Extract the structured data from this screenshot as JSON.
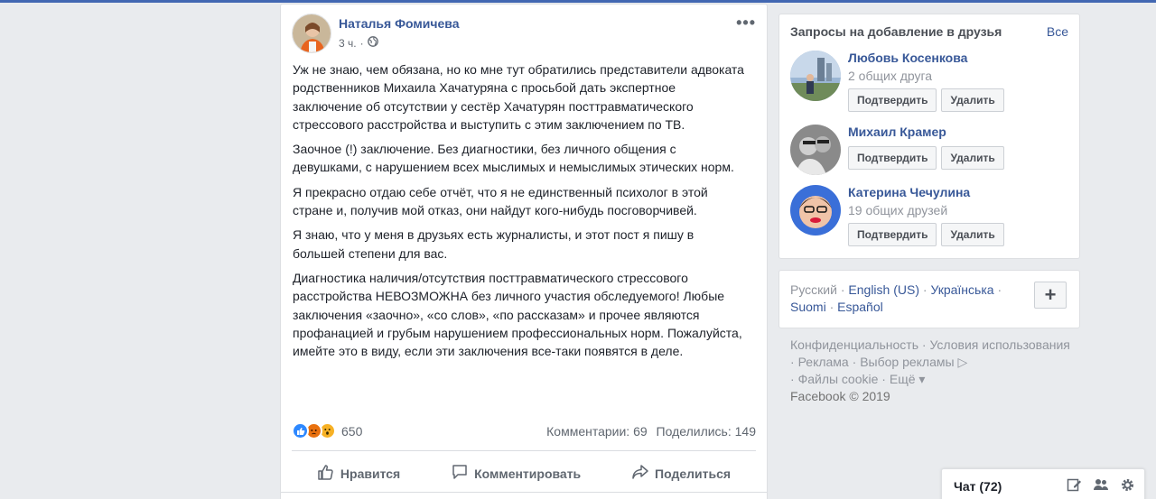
{
  "post": {
    "author": "Наталья Фомичева",
    "time": "3 ч.",
    "separator": "·",
    "paragraphs": [
      "Уж не знаю, чем обязана, но ко мне тут обратились представители адвоката родственников Михаила Хачатуряна с просьбой дать экспертное заключение об отсутствии у сестёр Хачатурян посттравматического стрессового расстройства и выступить с этим заключением по ТВ.",
      "Заочное (!) заключение. Без диагностики, без личного общения с девушками, с нарушением всех мыслимых и немыслимых этических норм.",
      "Я прекрасно отдаю себе отчёт, что я не единственный психолог в этой стране и, получив мой отказ, они найдут кого-нибудь посговорчивей.",
      "Я знаю, что у меня в друзьях есть журналисты, и этот пост я пишу в большей степени для вас.",
      "Диагностика наличия/отсутствия посттравматического стрессового расстройства НЕВОЗМОЖНА без личного участия обследуемого! Любые заключения «заочно», «со слов», «по рассказам» и прочее являются профанацией и грубым нарушением профессиональных норм. Пожалуйста, имейте это в виду, если эти заключения все-таки появятся в деле."
    ],
    "reactions_count": "650",
    "comments": "Комментарии: 69",
    "shares": "Поделились: 149",
    "actions": {
      "like": "Нравится",
      "comment": "Комментировать",
      "share": "Поделиться"
    }
  },
  "friend_requests": {
    "title": "Запросы на добавление в друзья",
    "see_all": "Все",
    "confirm": "Подтвердить",
    "delete": "Удалить",
    "items": [
      {
        "name": "Любовь Косенкова",
        "mutual": "2 общих друга"
      },
      {
        "name": "Михаил Крамер",
        "mutual": ""
      },
      {
        "name": "Катерина Чечулина",
        "mutual": "19 общих друзей"
      }
    ]
  },
  "languages": {
    "current": "Русский",
    "options": [
      "English (US)",
      "Українська",
      "Suomi",
      "Español"
    ],
    "sep": " · "
  },
  "footer": {
    "links": [
      "Конфиденциальность",
      "Условия использования",
      "Реклама",
      "Выбор рекламы",
      "Файлы cookie",
      "Ещё"
    ],
    "copyright": "Facebook © 2019"
  },
  "chat": {
    "label": "Чат (72)"
  },
  "colors": {
    "link": "#385898",
    "background": "#e9ebee",
    "accent": "#4267b2"
  }
}
